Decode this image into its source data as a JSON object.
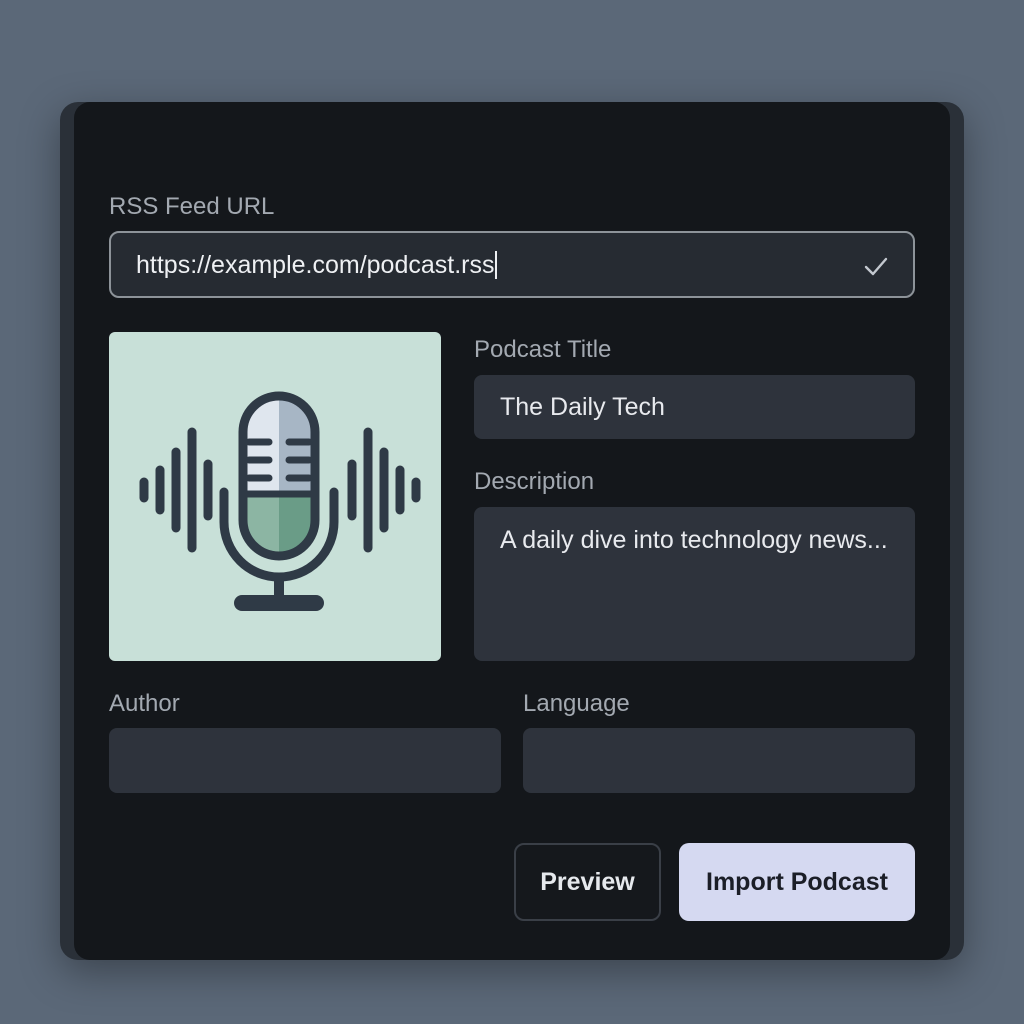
{
  "form": {
    "rss_label": "RSS Feed URL",
    "rss_value": "https://example.com/podcast.rss",
    "title_label": "Podcast Title",
    "title_value": "The Daily Tech",
    "description_label": "Description",
    "description_value": "A daily dive into technology news...",
    "author_label": "Author",
    "author_value": "",
    "language_label": "Language",
    "language_value": ""
  },
  "artwork": {
    "icon": "microphone-soundwave-icon",
    "bg_color": "#c8e0d8"
  },
  "actions": {
    "preview_label": "Preview",
    "import_label": "Import Podcast"
  },
  "colors": {
    "accent_button": "#d5d9f1",
    "card_background": "#14171b",
    "field_background": "#2e333c"
  }
}
